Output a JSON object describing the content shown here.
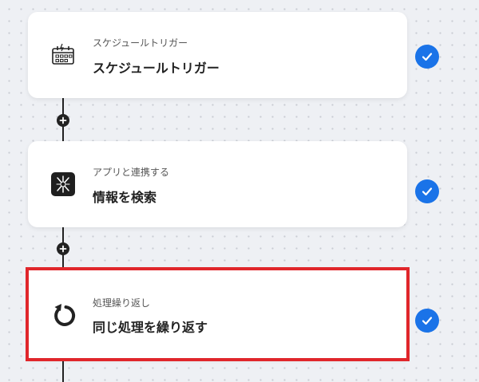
{
  "colors": {
    "accent": "#1a73e8",
    "selection": "#e0262b",
    "connector": "#222222"
  },
  "steps": [
    {
      "subtitle": "スケジュールトリガー",
      "title": "スケジュールトリガー",
      "icon": "calendar-clock-icon",
      "status": "completed"
    },
    {
      "subtitle": "アプリと連携する",
      "title": "情報を検索",
      "icon": "app-integration-icon",
      "status": "completed"
    },
    {
      "subtitle": "処理繰り返し",
      "title": "同じ処理を繰り返す",
      "icon": "loop-arrow-icon",
      "status": "completed",
      "selected": true
    }
  ],
  "add_nodes": [
    "plus-icon",
    "plus-icon"
  ]
}
